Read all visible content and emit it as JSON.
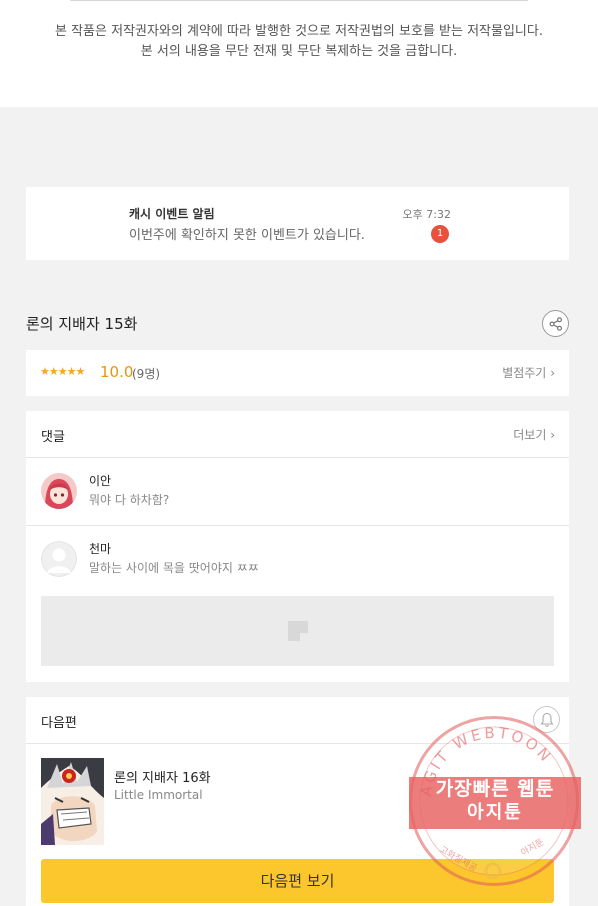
{
  "notice": {
    "line1": "본 작품은 저작권자와의 계약에 따라 발행한 것으로 저작권법의 보호를 받는 저작물입니다.",
    "line2": "본 서의 내용을 무단 전재 및 무단 복제하는 것을 금합니다."
  },
  "event": {
    "title": "캐시 이벤트 알림",
    "message": "이번주에 확인하지 못한 이벤트가 있습니다.",
    "time": "오후 7:32",
    "badge": "1"
  },
  "episode": {
    "title": "론의 지배자 15화",
    "share_icon": "share-icon"
  },
  "rating": {
    "stars": "★★★★★",
    "score": "10.0",
    "count": "(9명)",
    "rate_button": "별점주기",
    "value_out_of_5": 5
  },
  "comments": {
    "header": "댓글",
    "more": "더보기",
    "items": [
      {
        "name": "이안",
        "text": "뭐야 다 하차함?"
      },
      {
        "name": "천마",
        "text": "말하는 사이에 목을 땃어야지 ㅉㅉ"
      }
    ]
  },
  "next": {
    "header": "다음편",
    "episode_title": "론의 지배자 16화",
    "episode_subtitle": "Little Immortal",
    "button": "다음편 보기",
    "bell_icon": "bell-icon"
  },
  "watermark": {
    "ring_text": "AGIT WEBTOON",
    "line1": "가장빠른 웹툰",
    "line2": "아지툰",
    "bottom_left": "고화질제공",
    "bottom_right": "아지툰"
  },
  "colors": {
    "accent_orange": "#e8930c",
    "badge_red": "#e5533d",
    "button_yellow": "#fbc72c",
    "watermark_red": "#e86060"
  }
}
